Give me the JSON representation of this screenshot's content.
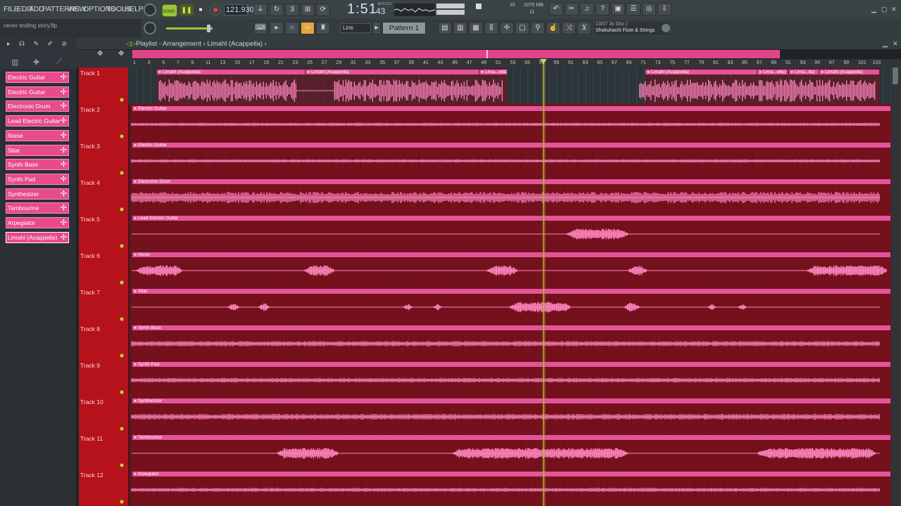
{
  "menu": [
    "FILE",
    "EDIT",
    "ADD",
    "PATTERNS",
    "VIEW",
    "OPTIONS",
    "TOOLS",
    "HELP"
  ],
  "transport": {
    "song_label": "SONG",
    "tempo": "121.930",
    "time_main": "1:51",
    "time_sub": "43",
    "time_unit": "M:S:CS",
    "cpu": "15",
    "memory": "1075 MB",
    "polyphony": "11"
  },
  "project": {
    "filename": "never ending story.flp"
  },
  "toolbar": {
    "snap": "Line",
    "pattern": "Pattern 1"
  },
  "hint": {
    "line1": "13/07  3x Osc |",
    "line2": "Shakuhachi Flute & Strings"
  },
  "playlist": {
    "breadcrumb": "Playlist - Arrangement › Limahl (Acappella) ›"
  },
  "channels": [
    "Electric Guitar",
    "Electric Guitar",
    "Electronic Drum",
    "Lead Electric Guitar",
    "Noise",
    "Sitar",
    "Synth Bass",
    "Synth Pad",
    "Synthesizer",
    "Tambourine",
    "Arpegiator",
    "Limahl (Acappella)"
  ],
  "ruler": [
    "1",
    "3",
    "5",
    "7",
    "9",
    "11",
    "13",
    "15",
    "17",
    "19",
    "21",
    "23",
    "25",
    "27",
    "29",
    "31",
    "33",
    "35",
    "37",
    "39",
    "41",
    "43",
    "45",
    "47",
    "49",
    "51",
    "53",
    "55",
    "57",
    "59",
    "61",
    "63",
    "65",
    "67",
    "69",
    "71",
    "73",
    "75",
    "77",
    "79",
    "81",
    "83",
    "85",
    "87",
    "89",
    "91",
    "93",
    "95",
    "97",
    "99",
    "101",
    "103"
  ],
  "tracks": [
    {
      "name": "Track 1",
      "clips": [
        {
          "label": "Limahl (Acappella)",
          "start": 0.037,
          "end": 0.232
        },
        {
          "label": "Limahl (Acappella)",
          "start": 0.232,
          "end": 0.46
        },
        {
          "label": "Lima...ella)",
          "start": 0.46,
          "end": 0.497
        },
        {
          "label": "Limahl (Acappella)",
          "start": 0.678,
          "end": 0.825
        },
        {
          "label": "Lima...ella)",
          "start": 0.825,
          "end": 0.866
        },
        {
          "label": "Lima...lla)",
          "start": 0.866,
          "end": 0.906
        },
        {
          "label": "Limahl (Acappella)",
          "start": 0.906,
          "end": 0.985
        }
      ]
    },
    {
      "name": "Track 2",
      "clips": [
        {
          "label": "Electric Guitar",
          "start": 0.005,
          "end": 1.0
        }
      ]
    },
    {
      "name": "Track 3",
      "clips": [
        {
          "label": "Electric Guitar",
          "start": 0.005,
          "end": 1.0
        }
      ]
    },
    {
      "name": "Track 4",
      "clips": [
        {
          "label": "Electronic Drum",
          "start": 0.005,
          "end": 1.0
        }
      ]
    },
    {
      "name": "Track 5",
      "clips": [
        {
          "label": "Lead Electric Guitar",
          "start": 0.005,
          "end": 1.0
        }
      ]
    },
    {
      "name": "Track 6",
      "clips": [
        {
          "label": "Noise",
          "start": 0.005,
          "end": 1.0
        }
      ]
    },
    {
      "name": "Track 7",
      "clips": [
        {
          "label": "Sitar",
          "start": 0.005,
          "end": 1.0
        }
      ]
    },
    {
      "name": "Track 8",
      "clips": [
        {
          "label": "Synth Bass",
          "start": 0.005,
          "end": 1.0
        }
      ]
    },
    {
      "name": "Track 9",
      "clips": [
        {
          "label": "Synth Pad",
          "start": 0.005,
          "end": 1.0
        }
      ]
    },
    {
      "name": "Track 10",
      "clips": [
        {
          "label": "Synthesizer",
          "start": 0.005,
          "end": 1.0
        }
      ]
    },
    {
      "name": "Track 11",
      "clips": [
        {
          "label": "Tambourine",
          "start": 0.005,
          "end": 1.0
        }
      ]
    },
    {
      "name": "Track 12",
      "clips": [
        {
          "label": "Arpegiator",
          "start": 0.005,
          "end": 1.0
        }
      ]
    }
  ],
  "colors": {
    "clip": "#e3559a",
    "track_header": "#b5121b",
    "wave": "#ff86c0",
    "accent": "#9ac53a"
  }
}
